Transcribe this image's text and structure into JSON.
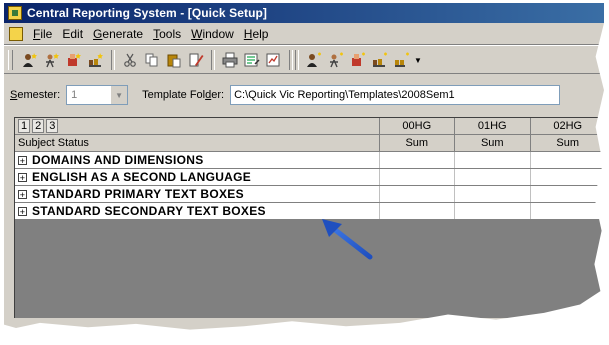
{
  "window": {
    "title": "Central Reporting System - [Quick Setup]"
  },
  "menu": [
    {
      "label_u": "F",
      "label_rest": "ile"
    },
    {
      "label_u": "",
      "label_rest": "Edit"
    },
    {
      "label_u": "G",
      "label_rest": "enerate"
    },
    {
      "label_u": "T",
      "label_rest": "ools"
    },
    {
      "label_u": "W",
      "label_rest": "indow"
    },
    {
      "label_u": "H",
      "label_rest": "elp"
    }
  ],
  "toolbar": {
    "icons": [
      "student-add-icon",
      "student-star-icon",
      "teacher-add-icon",
      "class-add-icon",
      "cut-icon",
      "copy-icon",
      "paste-icon",
      "edit-icon",
      "print-icon",
      "report-icon",
      "preview-icon",
      "student-icon-2",
      "student-star-icon-2",
      "teacher-icon-2",
      "class-icon-2",
      "class-all-icon"
    ]
  },
  "filters": {
    "semester_label_u": "S",
    "semester_label_rest": "emester:",
    "semester_value": "1",
    "template_label_pre": "Template Fol",
    "template_label_u": "d",
    "template_label_post": "er:",
    "template_folder": "C:\\Quick Vic Reporting\\Templates\\2008Sem1"
  },
  "grid": {
    "levels": [
      "1",
      "2",
      "3"
    ],
    "columns": [
      "00HG",
      "01HG",
      "02HG"
    ],
    "subheader": {
      "label": "Subject Status",
      "values": [
        "Sum",
        "Sum",
        "Sum"
      ]
    },
    "groups": [
      "DOMAINS AND DIMENSIONS",
      "ENGLISH AS A SECOND LANGUAGE",
      "STANDARD PRIMARY TEXT BOXES",
      "STANDARD SECONDARY TEXT BOXES"
    ]
  },
  "colors": {
    "titlebar_start": "#0a246a",
    "titlebar_end": "#3a6ea5",
    "annotation_arrow": "#1f4fbf"
  }
}
